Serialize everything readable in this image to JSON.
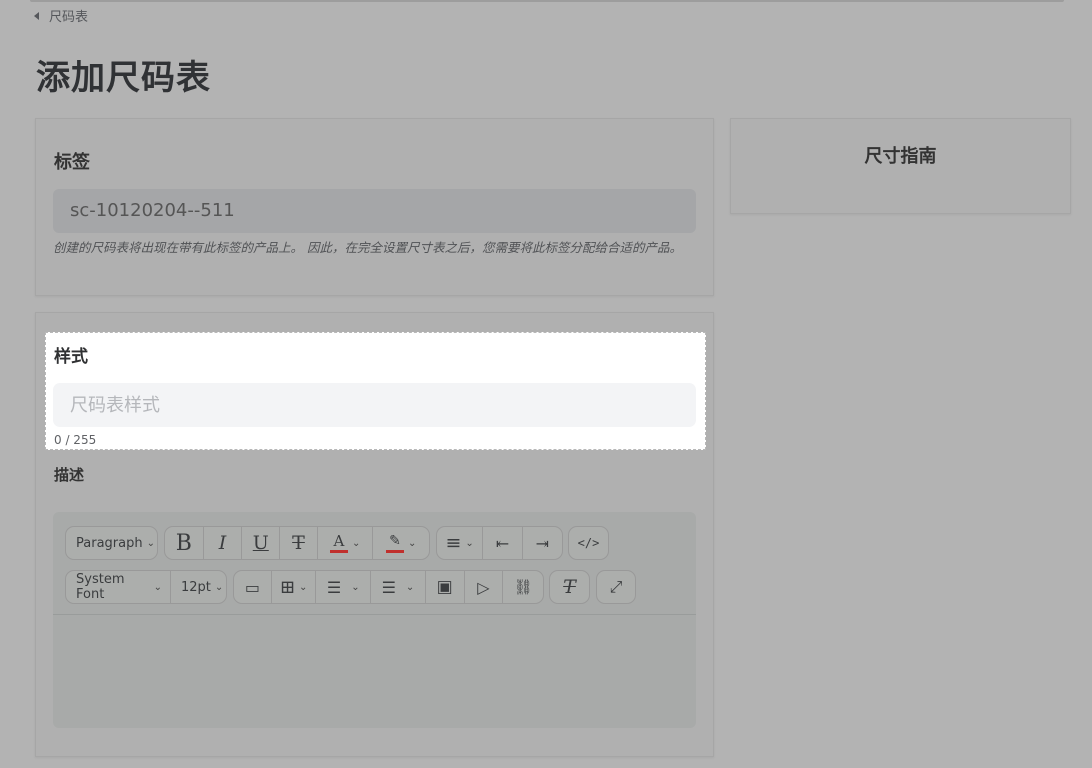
{
  "breadcrumb": {
    "back_label": "尺码表"
  },
  "page": {
    "title": "添加尺码表"
  },
  "tag_section": {
    "label": "标签",
    "value": "sc-10120204--511",
    "help": "创建的尺码表将出现在带有此标签的产品上。 因此，在完全设置尺寸表之后，您需要将此标签分配给合适的产品。"
  },
  "guide": {
    "title": "尺寸指南"
  },
  "style_section": {
    "label": "样式",
    "placeholder": "尺码表样式",
    "value": "",
    "counter": "0 / 255"
  },
  "description": {
    "label": "描述"
  },
  "editor": {
    "block_format": "Paragraph",
    "font_family": "System Font",
    "font_size": "12pt",
    "icons": {
      "bold": "B",
      "italic": "I",
      "underline": "U",
      "strike": "T",
      "text_color": "A",
      "highlight": "✎",
      "align": "≡",
      "outdent": "⇤",
      "indent": "⇥",
      "code": "</>",
      "hr": "▭",
      "table": "⊞",
      "bullet_list": "☰",
      "num_list": "☰",
      "image": "▣",
      "media": "▷",
      "link": "⛓",
      "clear_format": "T",
      "fullscreen": "⤢",
      "chevron": "⌄"
    },
    "accent_color": "#c0302d"
  }
}
